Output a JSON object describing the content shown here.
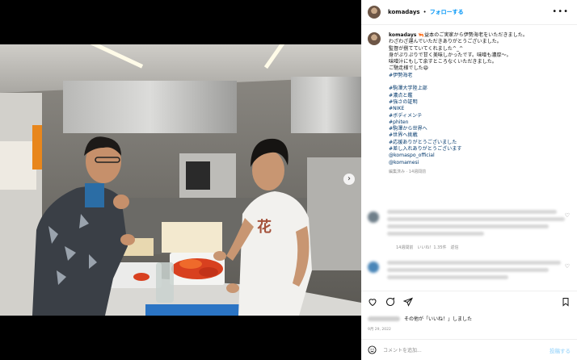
{
  "header": {
    "username": "komadays",
    "separator": "•",
    "follow_label": "フォローする",
    "more_label": "•••"
  },
  "caption": {
    "username": "komadays",
    "lines": [
      "🦐益本のご実家から伊勢海老をいただきました。",
      "わざわざ運んでいただきありがとうございました。",
      "監督が捌てていてくれました^_^",
      "身がぷりぷりで甘く美味しかったです。味噌も濃厚〜。",
      "味噌汁にもして余すところなくいただきました。",
      "ご馳走様でした😄"
    ],
    "tag_first": "#伊勢海老",
    "tags": [
      "#駒澤大学陸上部",
      "#濃点と鑑",
      "#強さの証明",
      "#NIKE",
      "#ボディメンテ",
      "#phiten",
      "#駒澤から世界へ",
      "#世界へ挑戦",
      "#応援ありがとうございました",
      "#差し入れありがとうございます",
      "@komaspo_official",
      "@komamesi"
    ],
    "meta": "編集済み · 14週間前"
  },
  "comments": [
    {
      "meta": "14週間前　いいね！1.35件　返信"
    },
    {
      "meta": ""
    }
  ],
  "likes": {
    "text": "その他が「いいね！」しました"
  },
  "date": "9月 29, 2022",
  "add_comment": {
    "placeholder": "コメントを追加...",
    "post_label": "投稿する"
  },
  "colors": {
    "accent": "#0095f6",
    "hashtag": "#00376b",
    "muted": "#8e8e8e"
  },
  "icons": [
    "more-icon",
    "heart-icon",
    "comment-icon",
    "share-icon",
    "bookmark-icon",
    "emoji-icon",
    "next-arrow-icon"
  ]
}
